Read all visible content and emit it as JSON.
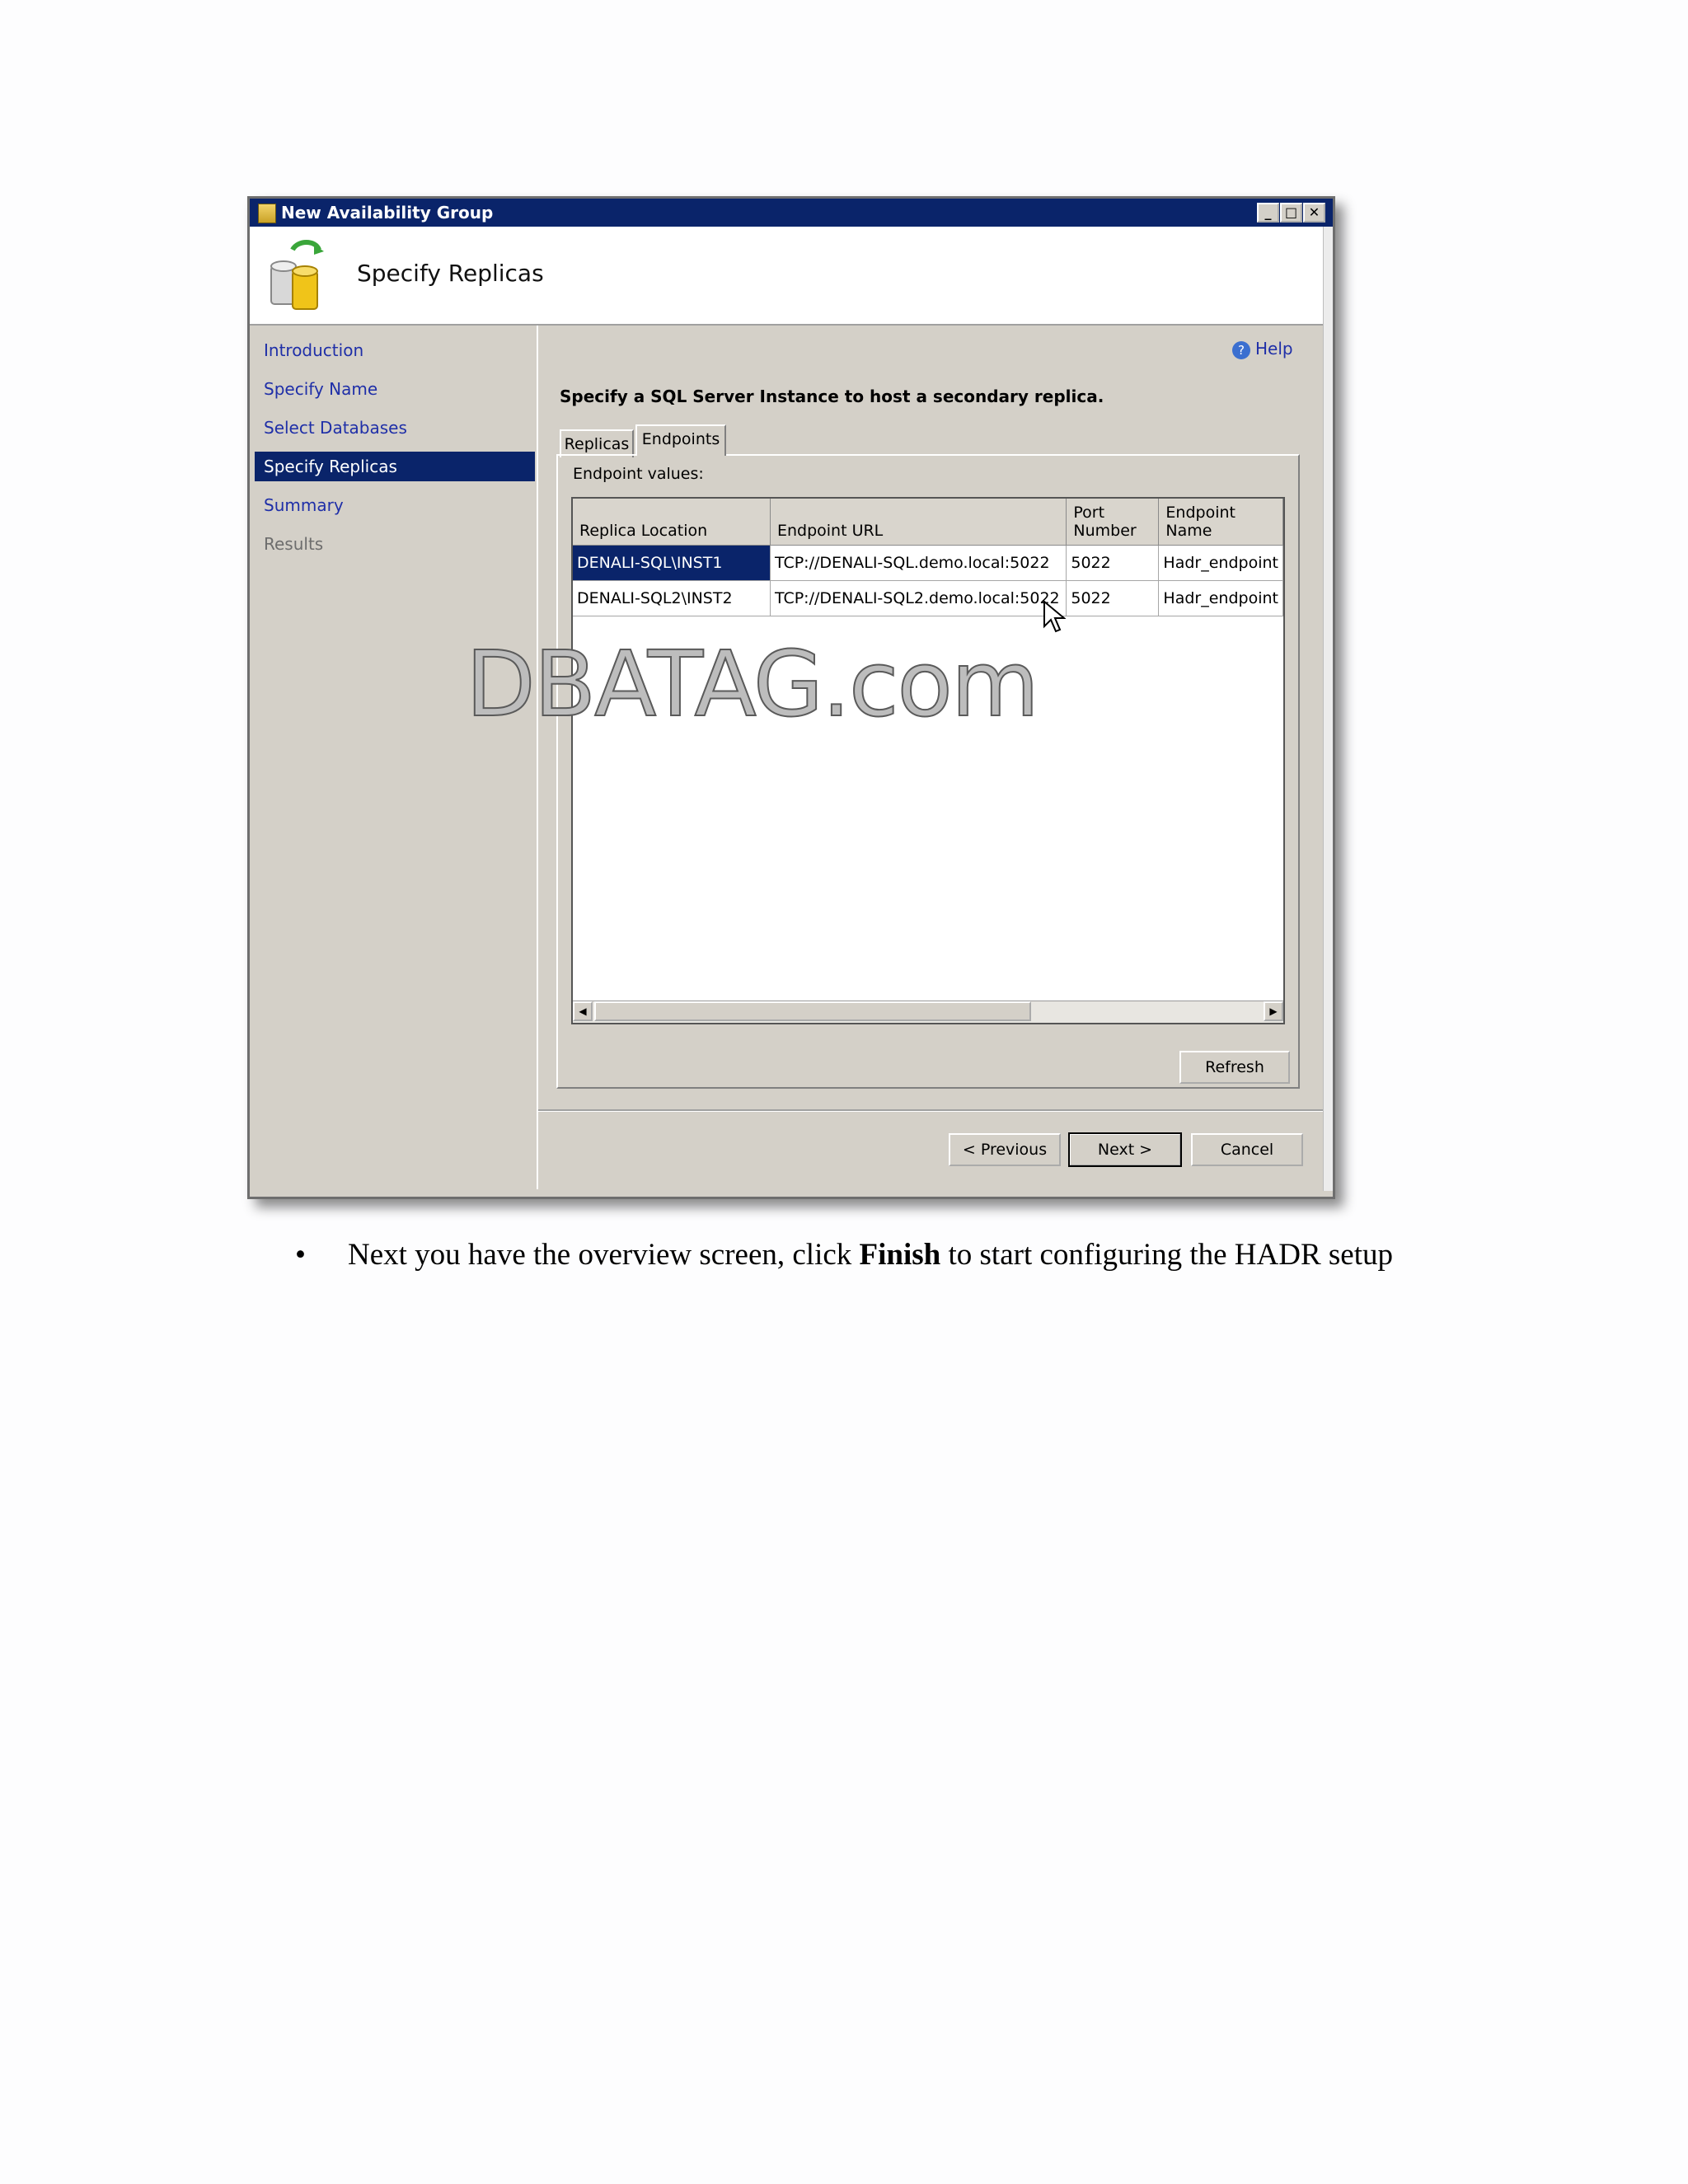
{
  "window": {
    "title": "New Availability Group",
    "header_title": "Specify Replicas"
  },
  "nav": {
    "items": [
      {
        "label": "Introduction",
        "state": "link"
      },
      {
        "label": "Specify Name",
        "state": "link"
      },
      {
        "label": "Select Databases",
        "state": "link"
      },
      {
        "label": "Specify Replicas",
        "state": "selected"
      },
      {
        "label": "Summary",
        "state": "link"
      },
      {
        "label": "Results",
        "state": "disabled"
      }
    ]
  },
  "help_label": "Help",
  "instruction": "Specify a SQL Server Instance to host a secondary replica.",
  "tabs": [
    {
      "label": "Replicas",
      "active": false
    },
    {
      "label": "Endpoints",
      "active": true
    }
  ],
  "endpoints": {
    "section_label": "Endpoint values:",
    "columns": [
      "Replica Location",
      "Endpoint URL",
      "Port Number",
      "Endpoint Name"
    ],
    "rows": [
      [
        "DENALI-SQL\\INST1",
        "TCP://DENALI-SQL.demo.local:5022",
        "5022",
        "Hadr_endpoint"
      ],
      [
        "DENALI-SQL2\\INST2",
        "TCP://DENALI-SQL2.demo.local:5022",
        "5022",
        "Hadr_endpoint"
      ]
    ]
  },
  "buttons": {
    "refresh": "Refresh",
    "previous": "< Previous",
    "next": "Next >",
    "cancel": "Cancel"
  },
  "watermark": "DBATAG.com",
  "document": {
    "bullet_before": "Next you have the overview screen, click ",
    "bullet_bold": "Finish",
    "bullet_after": " to start configuring the HADR setup"
  },
  "colors": {
    "selection": "#0a246a",
    "link": "#1f2fa8",
    "dialog_face": "#d4d0c8"
  }
}
